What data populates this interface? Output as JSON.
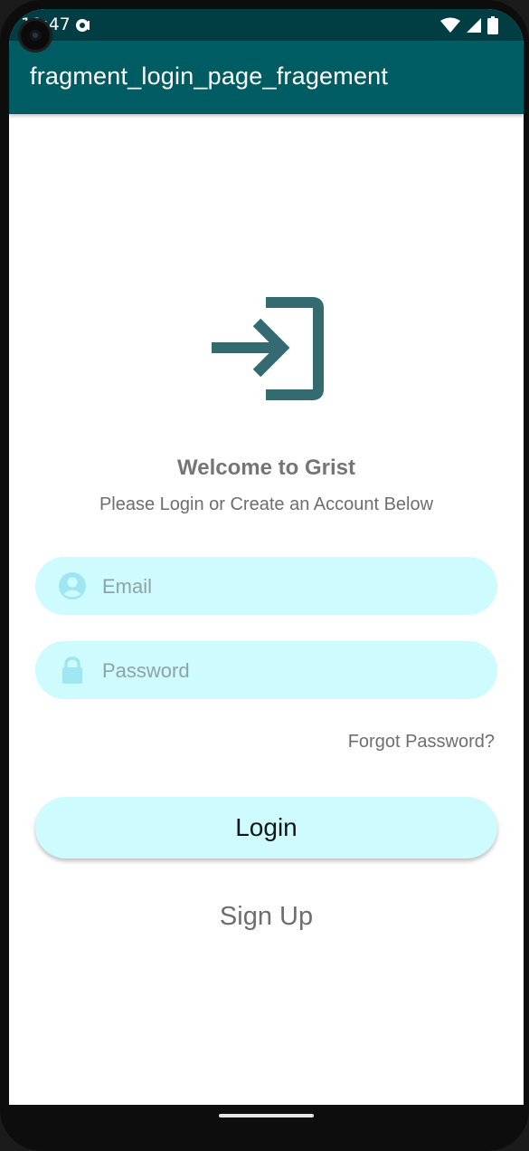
{
  "status_bar": {
    "time": "11:47",
    "notification_icon": "sync-icon",
    "wifi_icon": "wifi-icon",
    "signal_icon": "cell-signal-icon",
    "battery_icon": "battery-icon"
  },
  "app_bar": {
    "title": "fragment_login_page_fragement"
  },
  "hero": {
    "icon": "login-arrow-icon",
    "icon_color": "#336b70"
  },
  "welcome": {
    "title": "Welcome to Grist",
    "subtitle": "Please Login or Create an Account Below"
  },
  "form": {
    "email": {
      "placeholder": "Email",
      "value": "",
      "icon": "account-circle-icon"
    },
    "password": {
      "placeholder": "Password",
      "value": "",
      "icon": "lock-icon"
    },
    "forgot_label": "Forgot Password?",
    "login_label": "Login",
    "signup_label": "Sign Up"
  },
  "colors": {
    "status_bar": "#003e44",
    "app_bar": "#005c63",
    "field_bg": "#cdfbfe",
    "field_icon": "#9fe6f2",
    "muted_text": "#757575"
  }
}
